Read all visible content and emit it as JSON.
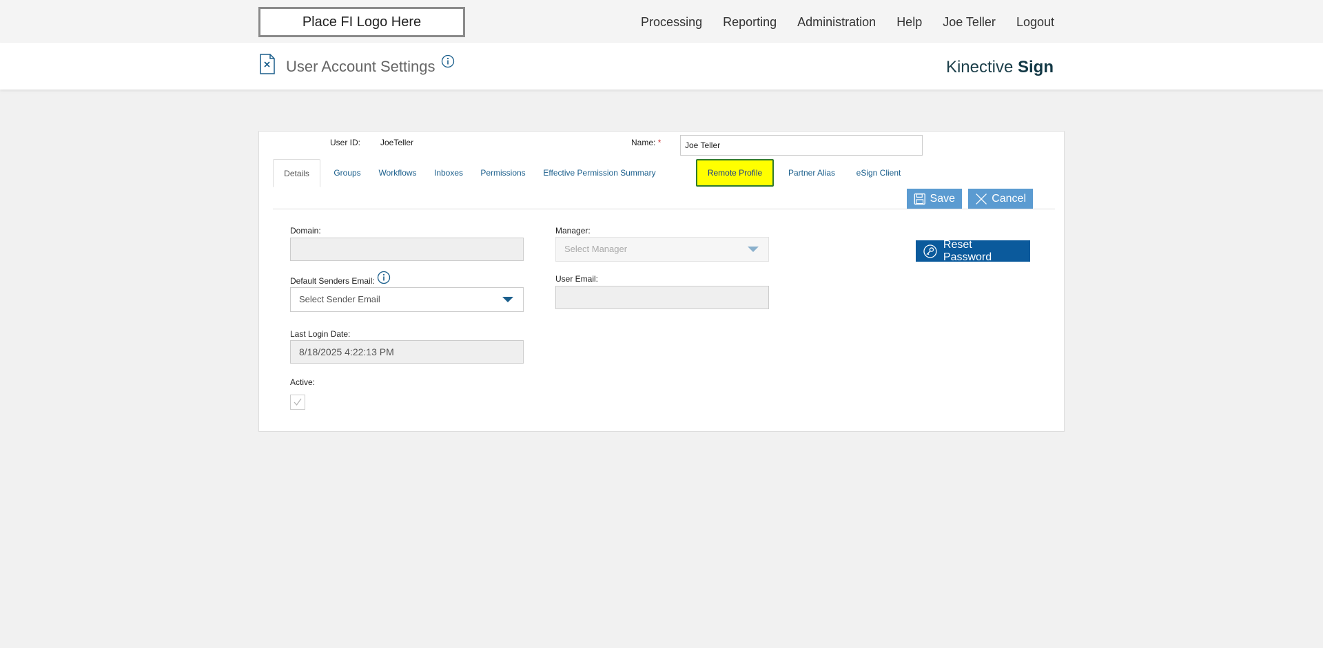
{
  "topbar": {
    "logo_text": "Place FI Logo Here",
    "nav": [
      "Processing",
      "Reporting",
      "Administration",
      "Help",
      "Joe Teller",
      "Logout"
    ]
  },
  "header": {
    "title": "User Account Settings",
    "brand_light": "Kinective ",
    "brand_bold": "Sign"
  },
  "user": {
    "id_label": "User ID:",
    "id_value": "JoeTeller",
    "name_label": "Name:",
    "name_required": "*",
    "name_value": "Joe Teller"
  },
  "tabs": [
    "Details",
    "Groups",
    "Workflows",
    "Inboxes",
    "Permissions",
    "Effective Permission Summary",
    "Remote Profile",
    "Partner Alias",
    "eSign Client"
  ],
  "actions": {
    "save": "Save",
    "cancel": "Cancel",
    "reset_password": "Reset Password"
  },
  "form": {
    "domain_label": "Domain:",
    "domain_value": "",
    "manager_label": "Manager:",
    "manager_placeholder": "Select Manager",
    "default_sender_label": "Default Senders Email:",
    "default_sender_placeholder": "Select Sender Email",
    "user_email_label": "User Email:",
    "user_email_value": "",
    "last_login_label": "Last Login Date:",
    "last_login_value": "8/18/2025 4:22:13 PM",
    "active_label": "Active:",
    "active_checked": true
  },
  "colors": {
    "accent": "#0b5a9c",
    "button_light": "#5b9bd1",
    "highlight": "#ffff00"
  }
}
